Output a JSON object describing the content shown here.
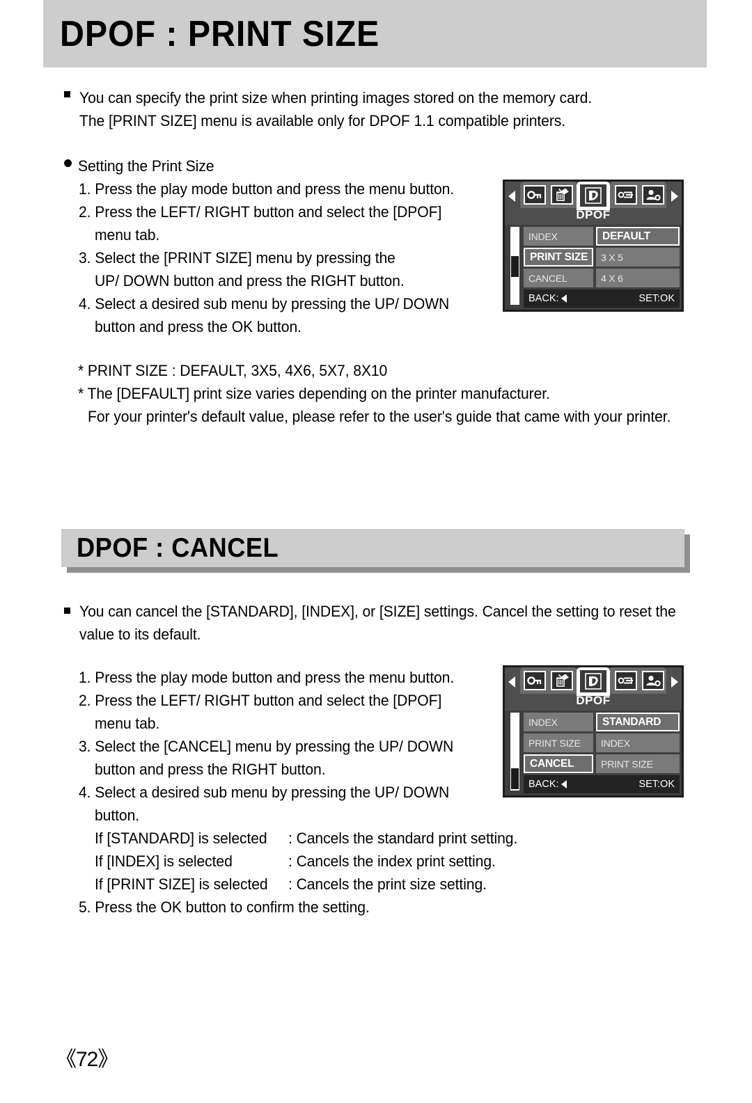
{
  "page": {
    "number": "《72》"
  },
  "section1": {
    "header": "DPOF : PRINT SIZE",
    "bullets": [
      "You can specify the print size when printing images stored on the memory card.",
      "The [PRINT SIZE] menu is available only for DPOF 1.1 compatible printers."
    ],
    "subheading": "Setting the Print Size",
    "steps": [
      "1. Press the play mode button and press the menu button.",
      "2. Press the LEFT/ RIGHT button and select the [DPOF]",
      "menu tab.",
      "3. Select the [PRINT SIZE] menu by pressing the",
      "UP/ DOWN button and press the RIGHT button.",
      "4. Select a desired sub menu by pressing the UP/ DOWN",
      "button and press the OK button."
    ],
    "notes": [
      "* PRINT SIZE : DEFAULT, 3X5, 4X6, 5X7, 8X10",
      "* The [DEFAULT] print size varies depending on the printer manufacturer.",
      "For your printer's default value, please refer to the user's guide that came with your printer."
    ]
  },
  "section2": {
    "header": "DPOF : CANCEL",
    "bullets": [
      "You can cancel the [STANDARD], [INDEX], or [SIZE] settings. Cancel the setting to reset the",
      "value to its default."
    ],
    "steps": [
      "1. Press the play mode button and press the menu button.",
      "2. Press the LEFT/ RIGHT button and select the [DPOF]",
      "menu tab.",
      "3. Select the [CANCEL] menu by pressing the UP/ DOWN",
      "button and press the RIGHT button.",
      "4. Select a desired sub menu by pressing the UP/ DOWN",
      "button."
    ],
    "conditions": [
      {
        "label": "If [STANDARD] is selected",
        "result": ": Cancels the standard print setting."
      },
      {
        "label": "If [INDEX] is selected",
        "result": ": Cancels the index print setting."
      },
      {
        "label": "If [PRINT SIZE] is selected",
        "result": ": Cancels the print size setting."
      }
    ],
    "final_step": "5. Press the OK button to confirm the setting."
  },
  "lcd1": {
    "title": "DPOF",
    "tabs": [
      {
        "icon": "key-icon",
        "selected": false
      },
      {
        "icon": "delete-trash-icon",
        "selected": false
      },
      {
        "icon": "dpof-icon",
        "selected": true
      },
      {
        "icon": "resize-camera-icon",
        "selected": false
      },
      {
        "icon": "portrait-person-icon",
        "selected": false
      }
    ],
    "rows": [
      {
        "left": "INDEX",
        "left_hl": false,
        "right": "DEFAULT",
        "right_hl": true
      },
      {
        "left": "PRINT SIZE",
        "left_hl": true,
        "right": "3 X 5",
        "right_hl": false
      },
      {
        "left": "CANCEL",
        "left_hl": false,
        "right": "4 X 6",
        "right_hl": false
      }
    ],
    "footer": {
      "back": "BACK:",
      "set": "SET:OK"
    },
    "scroll_thumb_position": "middle"
  },
  "lcd2": {
    "title": "DPOF",
    "tabs": [
      {
        "icon": "key-icon",
        "selected": false
      },
      {
        "icon": "delete-trash-icon",
        "selected": false
      },
      {
        "icon": "dpof-icon",
        "selected": true
      },
      {
        "icon": "resize-camera-icon",
        "selected": false
      },
      {
        "icon": "portrait-person-icon",
        "selected": false
      }
    ],
    "rows": [
      {
        "left": "INDEX",
        "left_hl": false,
        "right": "STANDARD",
        "right_hl": true
      },
      {
        "left": "PRINT SIZE",
        "left_hl": false,
        "right": "INDEX",
        "right_hl": false
      },
      {
        "left": "CANCEL",
        "left_hl": true,
        "right": "PRINT SIZE",
        "right_hl": false
      }
    ],
    "footer": {
      "back": "BACK:",
      "set": "SET:OK"
    },
    "scroll_thumb_position": "bottom"
  },
  "colors": {
    "header_band": "#cdcdcd",
    "header_shadow": "#8f8f8f",
    "lcd_bezel": "#1c1c1c",
    "lcd_bg": "#4e4e4e",
    "lcd_cell": "#7a7a7a"
  }
}
